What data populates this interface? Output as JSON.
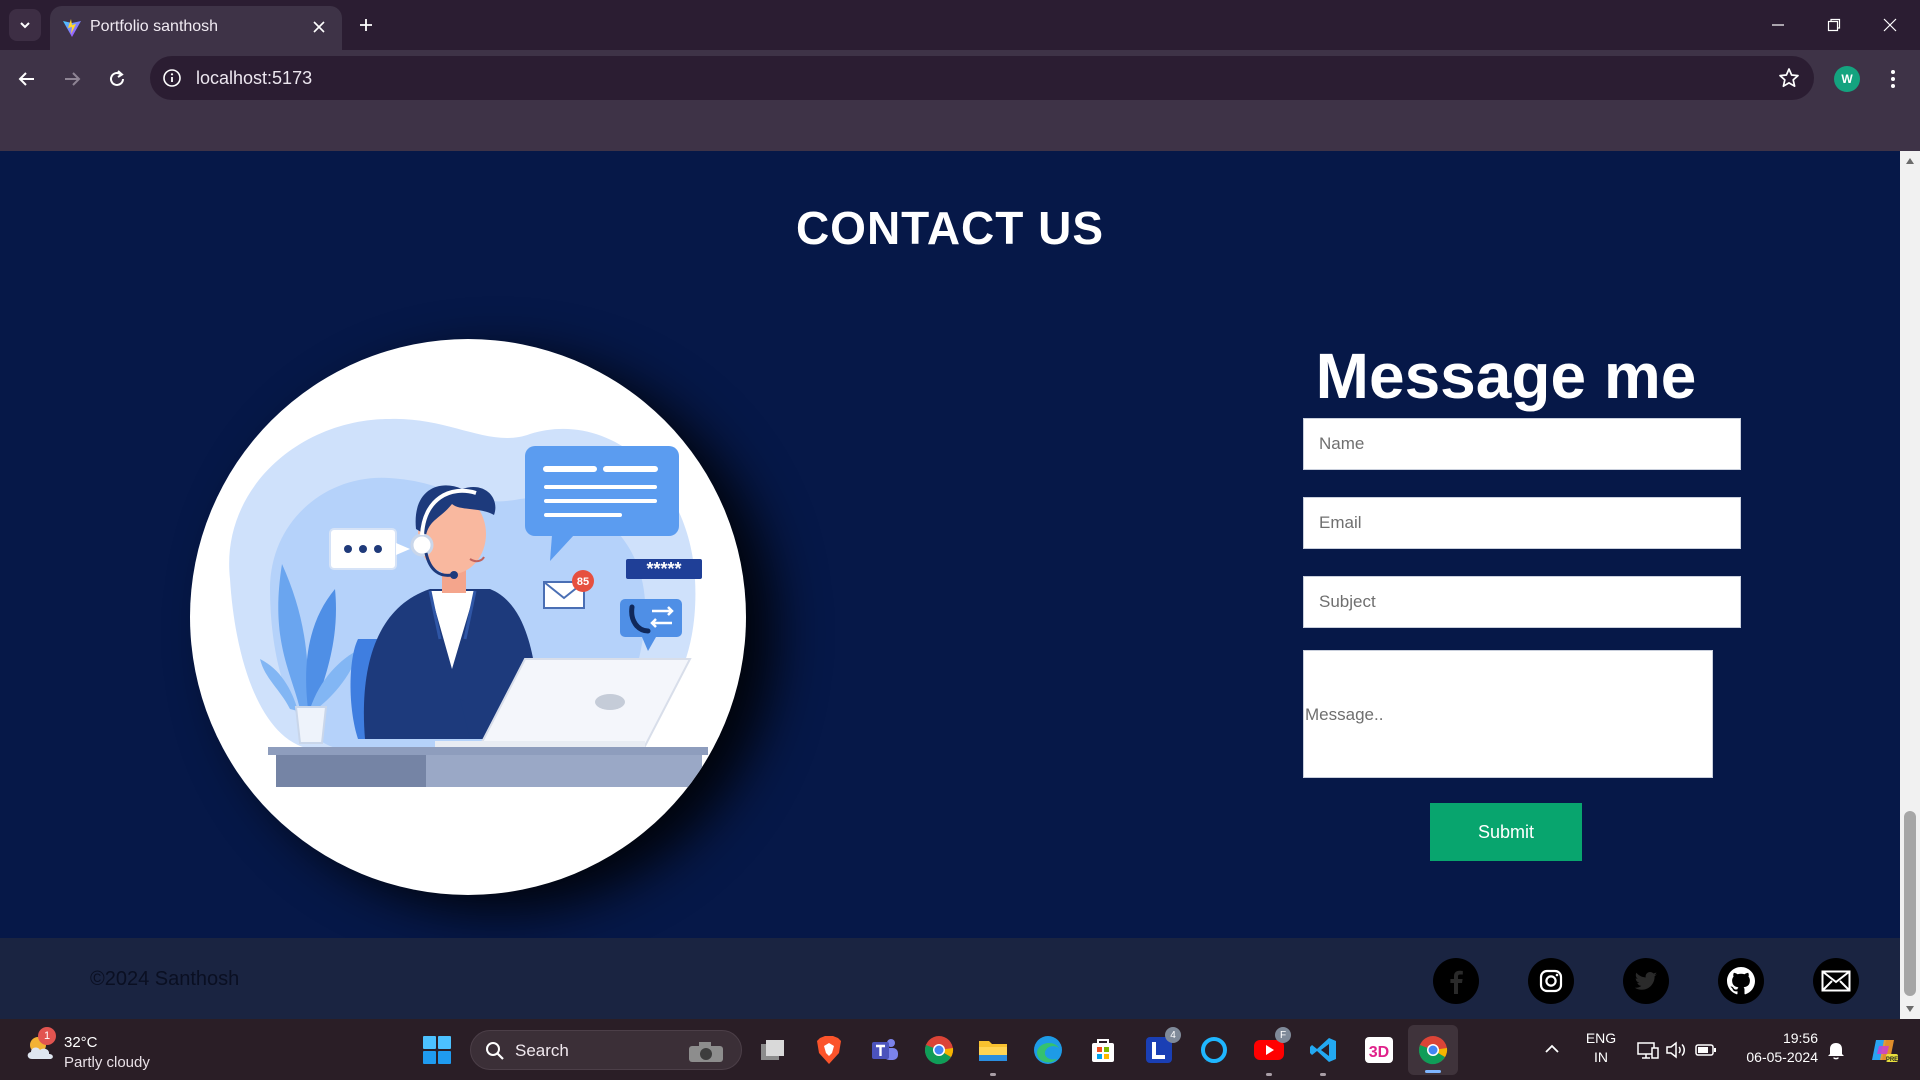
{
  "browser": {
    "tab_title": "Portfolio santhosh",
    "url": "localhost:5173",
    "profile_initial": "W"
  },
  "page": {
    "section_title": "CONTACT US",
    "form": {
      "title": "Message me",
      "name_placeholder": "Name",
      "email_placeholder": "Email",
      "subject_placeholder": "Subject",
      "message_placeholder": "Message..",
      "submit_label": "Submit"
    },
    "illustration": {
      "mail_badge": "85",
      "password_mask": "*****"
    },
    "footer": {
      "copyright": "©2024 Santhosh",
      "social": [
        "facebook-icon",
        "instagram-icon",
        "twitter-icon",
        "github-icon",
        "mail-icon"
      ]
    }
  },
  "taskbar": {
    "weather": {
      "temp": "32°C",
      "desc": "Partly cloudy",
      "badge": "1"
    },
    "search_label": "Search",
    "apps": [
      "task-view-icon",
      "brave-icon",
      "teams-icon",
      "chrome-icon",
      "file-explorer-icon",
      "edge-icon",
      "microsoft-store-icon",
      "l-app-icon",
      "alexa-icon",
      "youtube-icon",
      "vscode-icon",
      "3d-app-icon",
      "chrome-active-icon"
    ],
    "badges": {
      "l_app": "4",
      "youtube": "F"
    },
    "lang_line1": "ENG",
    "lang_line2": "IN",
    "time": "19:56",
    "date": "06-05-2024"
  },
  "colors": {
    "section_bg": "#061848",
    "footer_bg": "#1a2441",
    "submit_bg": "#08a56e",
    "tab_bg": "#3e3347",
    "taskbar_bg": "#2a1e26"
  }
}
